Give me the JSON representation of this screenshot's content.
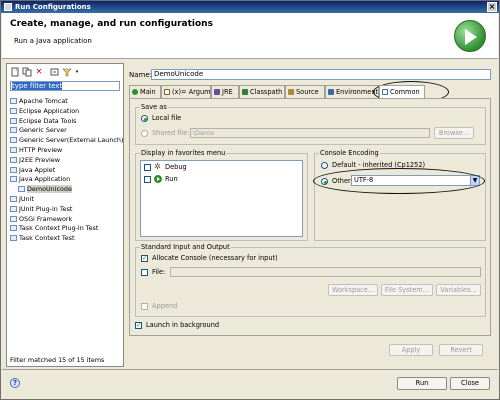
{
  "window": {
    "title": "Run Configurations"
  },
  "header": {
    "title": "Create, manage, and run configurations",
    "subtitle": "Run a Java application",
    "icon": "run-icon"
  },
  "left_panel": {
    "filter_placeholder": "type filter text",
    "items": [
      {
        "label": "Apache Tomcat",
        "level": 0
      },
      {
        "label": "Eclipse Application",
        "level": 0
      },
      {
        "label": "Eclipse Data Tools",
        "level": 0
      },
      {
        "label": "Generic Server",
        "level": 0
      },
      {
        "label": "Generic Server(External Launch)",
        "level": 0
      },
      {
        "label": "HTTP Preview",
        "level": 0
      },
      {
        "label": "J2EE Preview",
        "level": 0
      },
      {
        "label": "Java Applet",
        "level": 0
      },
      {
        "label": "Java Application",
        "level": 0
      },
      {
        "label": "DemoUnicode",
        "level": 1,
        "selected": true
      },
      {
        "label": "JUnit",
        "level": 0
      },
      {
        "label": "JUnit Plug-in Test",
        "level": 0
      },
      {
        "label": "OSGi Framework",
        "level": 0
      },
      {
        "label": "Task Context Plug-in Test",
        "level": 0
      },
      {
        "label": "Task Context Test",
        "level": 0
      }
    ],
    "status": "Filter matched 15 of 15 items"
  },
  "config": {
    "name_label": "Name:",
    "name_value": "DemoUnicode",
    "tabs": [
      {
        "label": "Main",
        "color": "#2f8f2f"
      },
      {
        "label": "(x)= Arguments",
        "color": "#8a5a2b"
      },
      {
        "label": "JRE",
        "color": "#6a4aa0"
      },
      {
        "label": "Classpath",
        "color": "#3a7a3a"
      },
      {
        "label": "Source",
        "color": "#b08a3a"
      },
      {
        "label": "Environment",
        "color": "#3a6aa0"
      },
      {
        "label": "Common",
        "color": "#3a6aa0",
        "active": true
      }
    ]
  },
  "common": {
    "save_as": {
      "title": "Save as",
      "local_file": "Local file",
      "shared_file": "Shared file:",
      "shared_value": "\\Demo",
      "browse": "Browse..."
    },
    "favorites": {
      "title": "Display in favorites menu",
      "items": [
        "Debug",
        "Run"
      ]
    },
    "encoding": {
      "title": "Console Encoding",
      "default_label": "Default - inherited (Cp1252)",
      "other_label": "Other",
      "other_value": "UTF-8"
    },
    "stdio": {
      "title": "Standard Input and Output",
      "allocate_console": "Allocate Console (necessary for input)",
      "file_label": "File:",
      "workspace": "Workspace...",
      "file_system": "File System...",
      "variables": "Variables...",
      "append": "Append"
    },
    "launch_background": "Launch in background",
    "apply": "Apply",
    "revert": "Revert"
  },
  "footer": {
    "run": "Run",
    "close": "Close"
  },
  "colors": {
    "title_bar": "#0a246a",
    "selection": "#316ac5",
    "run_green": "#2f8f2f"
  }
}
